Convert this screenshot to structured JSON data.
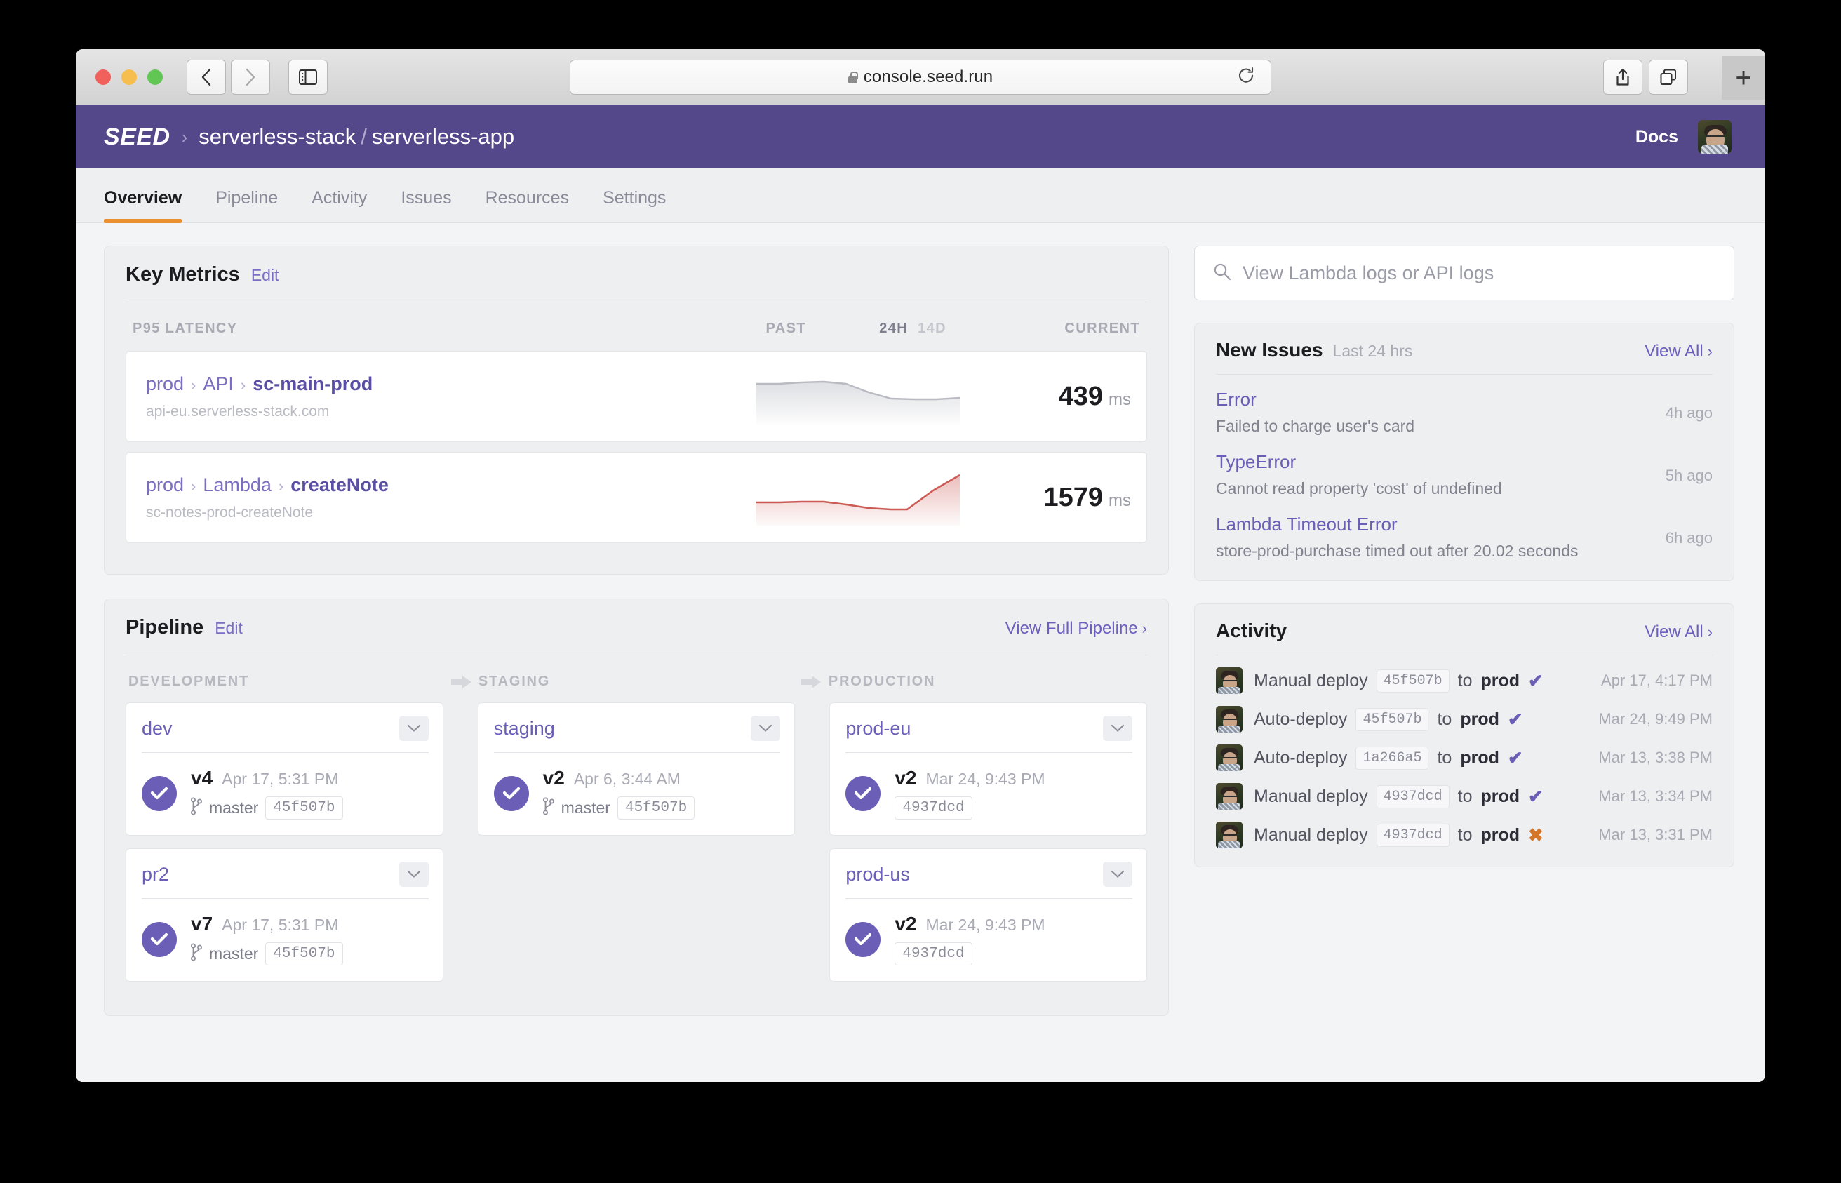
{
  "browser": {
    "url": "console.seed.run",
    "icons": {
      "back": "back-chevron-icon",
      "forward": "forward-chevron-icon",
      "sidebar": "sidebar-toggle-icon",
      "reload": "reload-icon",
      "share": "share-icon",
      "tabs": "tab-overview-icon",
      "newtab": "+"
    }
  },
  "header": {
    "logo": "SEED",
    "breadcrumb_sep": "›",
    "org": "serverless-stack",
    "slash": "/",
    "app": "serverless-app",
    "docs": "Docs",
    "avatar": "user-avatar"
  },
  "tabs": [
    {
      "label": "Overview",
      "active": true
    },
    {
      "label": "Pipeline",
      "active": false
    },
    {
      "label": "Activity",
      "active": false
    },
    {
      "label": "Issues",
      "active": false
    },
    {
      "label": "Resources",
      "active": false
    },
    {
      "label": "Settings",
      "active": false
    }
  ],
  "key_metrics": {
    "title": "Key Metrics",
    "edit": "Edit",
    "columns": {
      "name": "P95 LATENCY",
      "past": "PAST",
      "range_on": "24H",
      "range_off": "14D",
      "current": "CURRENT"
    },
    "rows": [
      {
        "stage": "prod",
        "type": "API",
        "name": "sc-main-prod",
        "sub": "api-eu.serverless-stack.com",
        "value": "439",
        "unit": "ms",
        "color": "#b9bac2",
        "spark": [
          52,
          52,
          50,
          49,
          52,
          60,
          66,
          67,
          67,
          66
        ]
      },
      {
        "stage": "prod",
        "type": "Lambda",
        "name": "createNote",
        "sub": "sc-notes-prod-createNote",
        "value": "1579",
        "unit": "ms",
        "color": "#cc5b55",
        "spark": [
          60,
          60,
          58,
          58,
          63,
          68,
          70,
          70,
          44,
          20
        ]
      }
    ]
  },
  "pipeline": {
    "title": "Pipeline",
    "edit": "Edit",
    "view_full": "View Full Pipeline",
    "chevron": "›",
    "columns": [
      "DEVELOPMENT",
      "STAGING",
      "PRODUCTION"
    ],
    "stages": [
      [
        {
          "name": "dev",
          "version": "v4",
          "date": "Apr 17, 5:31 PM",
          "branch": "master",
          "commit": "45f507b",
          "status": "success"
        },
        {
          "name": "pr2",
          "version": "v7",
          "date": "Apr 17, 5:31 PM",
          "branch": "master",
          "commit": "45f507b",
          "status": "success"
        }
      ],
      [
        {
          "name": "staging",
          "version": "v2",
          "date": "Apr 6, 3:44 AM",
          "branch": "master",
          "commit": "45f507b",
          "status": "success"
        }
      ],
      [
        {
          "name": "prod-eu",
          "version": "v2",
          "date": "Mar 24, 9:43 PM",
          "branch": "",
          "commit": "4937dcd",
          "status": "success"
        },
        {
          "name": "prod-us",
          "version": "v2",
          "date": "Mar 24, 9:43 PM",
          "branch": "",
          "commit": "4937dcd",
          "status": "success"
        }
      ]
    ]
  },
  "search": {
    "placeholder": "View Lambda logs or API logs",
    "icon": "search-icon"
  },
  "new_issues": {
    "title": "New Issues",
    "subtitle": "Last 24 hrs",
    "view_all": "View All",
    "chevron": "›",
    "items": [
      {
        "title": "Error",
        "desc": "Failed to charge user's card",
        "time": "4h ago"
      },
      {
        "title": "TypeError",
        "desc": "Cannot read property 'cost' of undefined",
        "time": "5h ago"
      },
      {
        "title": "Lambda Timeout Error",
        "desc": "store-prod-purchase timed out after 20.02 seconds",
        "time": "6h ago"
      }
    ]
  },
  "activity": {
    "title": "Activity",
    "view_all": "View All",
    "chevron": "›",
    "to_label": "to",
    "items": [
      {
        "action": "Manual deploy",
        "commit": "45f507b",
        "target": "prod",
        "status": "success",
        "time": "Apr 17, 4:17 PM"
      },
      {
        "action": "Auto-deploy",
        "commit": "45f507b",
        "target": "prod",
        "status": "success",
        "time": "Mar 24, 9:49 PM"
      },
      {
        "action": "Auto-deploy",
        "commit": "1a266a5",
        "target": "prod",
        "status": "success",
        "time": "Mar 13, 3:38 PM"
      },
      {
        "action": "Manual deploy",
        "commit": "4937dcd",
        "target": "prod",
        "status": "success",
        "time": "Mar 13, 3:34 PM"
      },
      {
        "action": "Manual deploy",
        "commit": "4937dcd",
        "target": "prod",
        "status": "failed",
        "time": "Mar 13, 3:31 PM"
      }
    ],
    "status_glyphs": {
      "success": "✔",
      "failed": "✖"
    }
  },
  "colors": {
    "brand_purple": "#54488a",
    "link_purple": "#6a5eb6",
    "accent_orange": "#ea9033",
    "error_red": "#cc5b55",
    "fail_orange": "#d4762a"
  }
}
